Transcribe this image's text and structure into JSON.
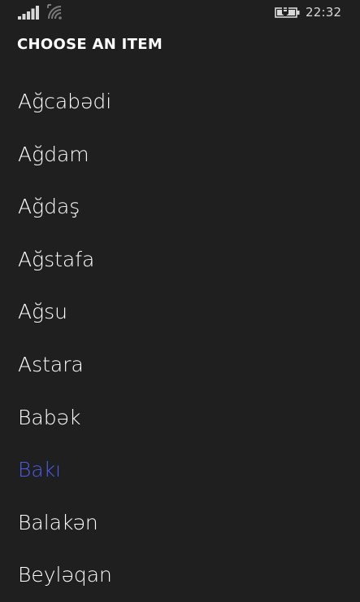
{
  "status_bar": {
    "time": "22:32",
    "icons": [
      "signal-strength-icon",
      "wifi-icon",
      "battery-charging-icon"
    ]
  },
  "header": {
    "title": "CHOOSE AN ITEM"
  },
  "list": {
    "items": [
      {
        "label": "Ağcabədi",
        "selected": false
      },
      {
        "label": "Ağdam",
        "selected": false
      },
      {
        "label": "Ağdaş",
        "selected": false
      },
      {
        "label": "Ağstafa",
        "selected": false
      },
      {
        "label": "Ağsu",
        "selected": false
      },
      {
        "label": "Astara",
        "selected": false
      },
      {
        "label": "Babək",
        "selected": false
      },
      {
        "label": "Bakı",
        "selected": true
      },
      {
        "label": "Balakən",
        "selected": false
      },
      {
        "label": "Beyləqan",
        "selected": false
      }
    ],
    "selected_color": "#4a5ee8",
    "text_color": "#ffffff",
    "background_color": "#1f1f1f"
  }
}
